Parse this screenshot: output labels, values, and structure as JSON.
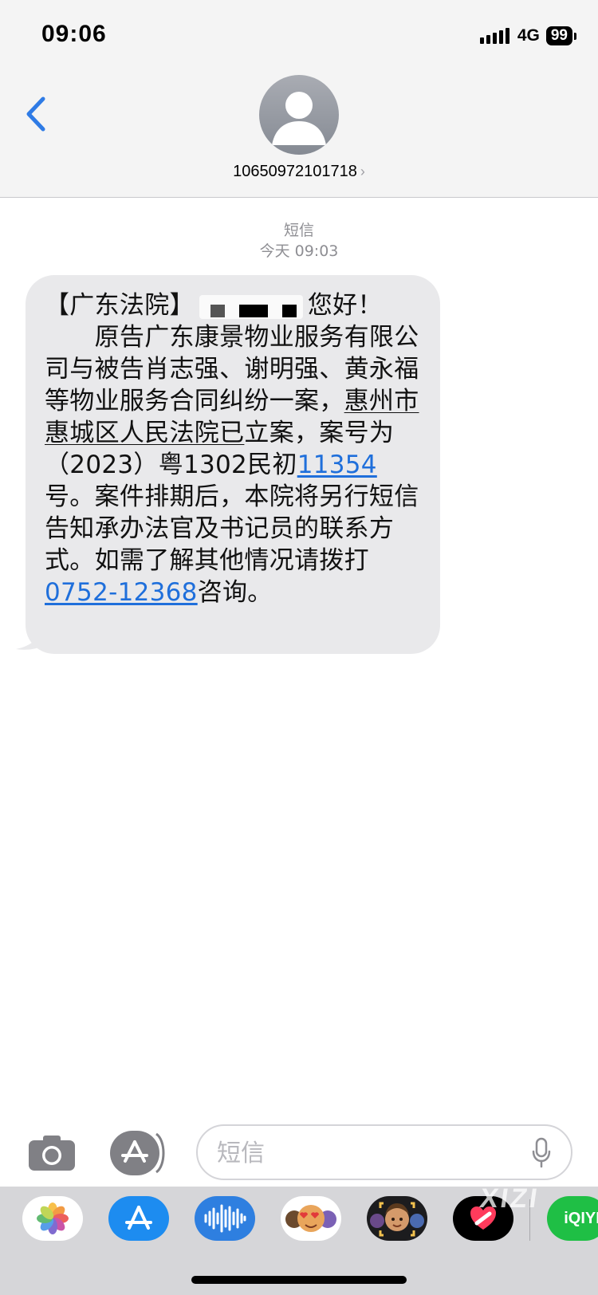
{
  "status_bar": {
    "time": "09:06",
    "network": "4G",
    "battery": "99"
  },
  "header": {
    "contact_number": "10650972101718",
    "chevron": "›"
  },
  "conversation": {
    "kind_label": "短信",
    "timestamp": "今天 09:03"
  },
  "message": {
    "prefix": "【广东法院】",
    "greeting": "您好！",
    "body_1": "　　原告广东康景物业服务有限公司与被告肖志强、谢明强、黄永福等物业服务合同纠纷一案，",
    "court": "惠州市惠城区人民法院已",
    "body_2": "立案，案号为（2023）粤1302民初",
    "case_no": "11354",
    "body_3": "号。案件排期后，本院将另行短信告知承办法官及书记员的联系方式。如需了解其他情况请拨打",
    "phone": "0752-12368",
    "body_4": "咨询。"
  },
  "input": {
    "placeholder": "短信"
  },
  "app_drawer": {
    "items": [
      "photos-app",
      "app-store-app",
      "audio-message-app",
      "memoji-stickers-app",
      "memoji-app",
      "digital-touch-app",
      "iqiyi-app"
    ],
    "iqiyi_label": "iQIYI"
  },
  "watermark": "XIZI",
  "colors": {
    "link": "#1f6fdb",
    "bubble": "#e9e9eb",
    "header_bg": "#f4f4f4",
    "back_chevron": "#2f7be5"
  }
}
